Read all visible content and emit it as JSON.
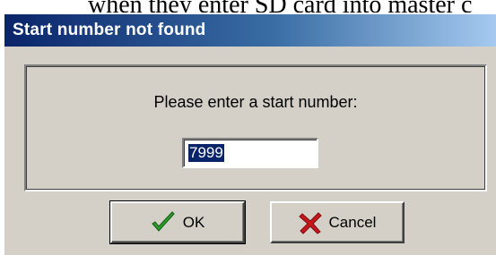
{
  "background_text": "when they enter SD card into master c",
  "dialog": {
    "title": "Start number not found",
    "prompt": "Please enter a start number:",
    "start_number": {
      "value": "7999",
      "selected": true
    },
    "buttons": {
      "ok": {
        "label": "OK",
        "icon": "check-icon",
        "icon_color": "#2a9d2a"
      },
      "cancel": {
        "label": "Cancel",
        "icon": "x-icon",
        "icon_color": "#c8161e"
      }
    }
  },
  "colors": {
    "title_bar_start": "#0a246a",
    "title_bar_end": "#a6caf0",
    "dialog_face": "#d4d0c8",
    "selection": "#0a246a"
  }
}
